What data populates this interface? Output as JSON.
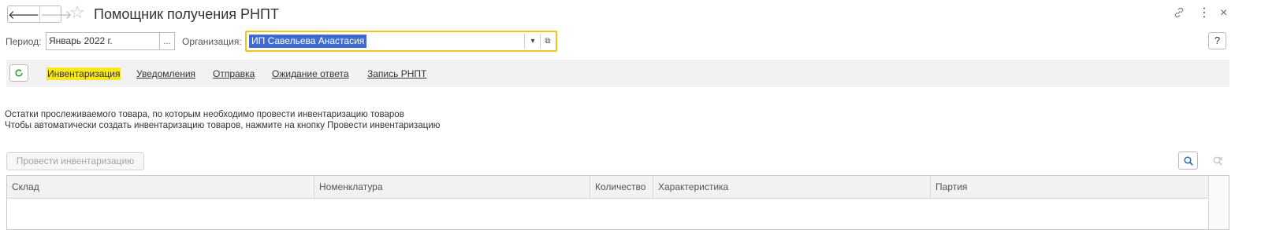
{
  "window": {
    "title": "Помощник получения РНПТ",
    "back_icon": "arrow-left-icon",
    "forward_icon": "arrow-right-icon",
    "favorite_icon": "star-icon",
    "link_icon": "link-icon",
    "menu_icon": "more-vertical-icon",
    "close_icon": "close-icon",
    "back_glyph": "🡐",
    "forward_glyph": "🡒",
    "star_glyph": "☆",
    "link_glyph": "🔗",
    "menu_glyph": "⋮",
    "close_glyph": "×"
  },
  "filters": {
    "period_label": "Период:",
    "period_value": "Январь 2022 г.",
    "period_btn": "...",
    "org_label": "Организация:",
    "org_value": "ИП Савельева Анастасия",
    "org_dropdown": "▾",
    "org_open": "⧉",
    "help": "?"
  },
  "tabs": {
    "refresh_glyph": "C",
    "items": [
      {
        "label": "Инвентаризация",
        "active": true
      },
      {
        "label": "Уведомления",
        "active": false
      },
      {
        "label": "Отправка",
        "active": false
      },
      {
        "label": "Ожидание ответа",
        "active": false
      },
      {
        "label": "Запись РНПТ",
        "active": false
      }
    ]
  },
  "info": {
    "line1": "Остатки прослеживаемого товара, по которым необходимо провести инвентаризацию товаров",
    "line2": "Чтобы автоматически создать инвентаризацию товаров, нажмите на кнопку Провести инвентаризацию"
  },
  "actions": {
    "run_label": "Провести инвентаризацию"
  },
  "table": {
    "columns": [
      "Склад",
      "Номенклатура",
      "Количество",
      "Характеристика",
      "Партия"
    ],
    "rows": []
  },
  "colors": {
    "accent_yellow": "#f0c419",
    "active_tab": "#f8e71c",
    "selection": "#3f6bd1",
    "refresh_green": "#3c9a3c"
  }
}
